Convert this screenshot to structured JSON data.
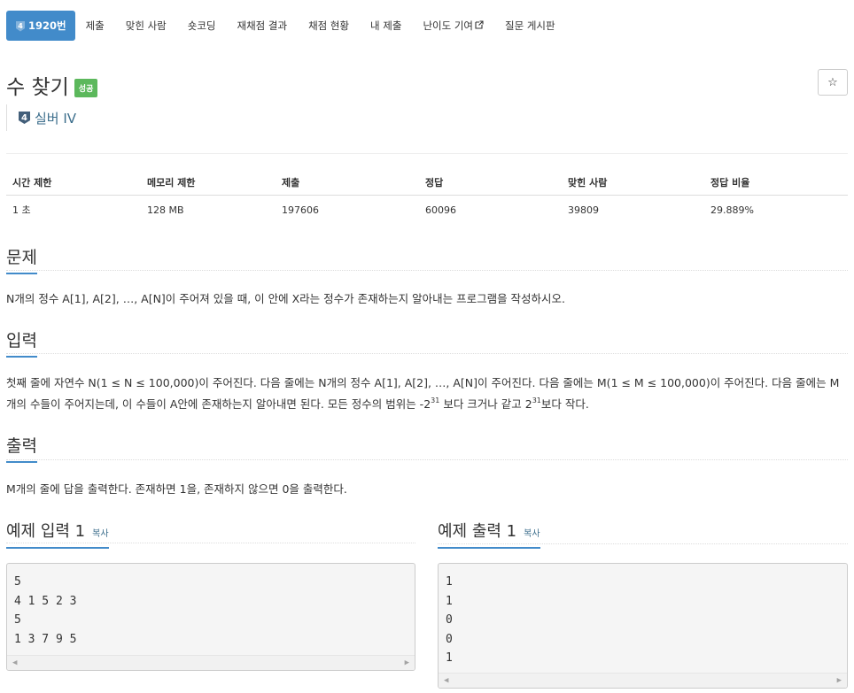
{
  "nav": {
    "items": [
      {
        "label": "1920번",
        "badge": "4",
        "active": true
      },
      {
        "label": "제출"
      },
      {
        "label": "맞힌 사람"
      },
      {
        "label": "숏코딩"
      },
      {
        "label": "재채점 결과"
      },
      {
        "label": "채점 현황"
      },
      {
        "label": "내 제출"
      },
      {
        "label": "난이도 기여",
        "icon": "external-link-icon"
      },
      {
        "label": "질문 게시판"
      }
    ]
  },
  "problem": {
    "title": "수 찾기",
    "status": "성공",
    "star": "☆",
    "tier_badge": "4",
    "tier": "실버 IV"
  },
  "info_table": {
    "headers": [
      "시간 제한",
      "메모리 제한",
      "제출",
      "정답",
      "맞힌 사람",
      "정답 비율"
    ],
    "values": [
      "1 초",
      "128 MB",
      "197606",
      "60096",
      "39809",
      "29.889%"
    ]
  },
  "sections": {
    "problem_title": "문제",
    "problem_text": "N개의 정수 A[1], A[2], …, A[N]이 주어져 있을 때, 이 안에 X라는 정수가 존재하는지 알아내는 프로그램을 작성하시오.",
    "input_title": "입력",
    "input_text_1": "첫째 줄에 자연수 N(1 ≤ N ≤ 100,000)이 주어진다. 다음 줄에는 N개의 정수 A[1], A[2], …, A[N]이 주어진다. 다음 줄에는 M(1 ≤ M ≤ 100,000)이 주어진다. 다음 줄에는 M",
    "input_text_2a": "개의 수들이 주어지는데, 이 수들이 A안에 존재하는지 알아내면 된다. 모든 정수의 범위는 -2",
    "input_sup_1": "31",
    "input_text_2b": " 보다 크거나 같고 2",
    "input_sup_2": "31",
    "input_text_2c": "보다 작다.",
    "output_title": "출력",
    "output_text": "M개의 줄에 답을 출력한다. 존재하면 1을, 존재하지 않으면 0을 출력한다."
  },
  "samples": {
    "input_title": "예제 입력 1",
    "output_title": "예제 출력 1",
    "copy_label": "복사",
    "input_lines": "5\n4 1 5 2 3\n5\n1 3 7 9 5",
    "output_lines": "1\n1\n0\n0\n1",
    "scroll_left": "◀",
    "scroll_right": "▶"
  },
  "colors": {
    "accent": "#428bca",
    "success": "#5cb85c",
    "tier_text": "#3c6e8c"
  }
}
